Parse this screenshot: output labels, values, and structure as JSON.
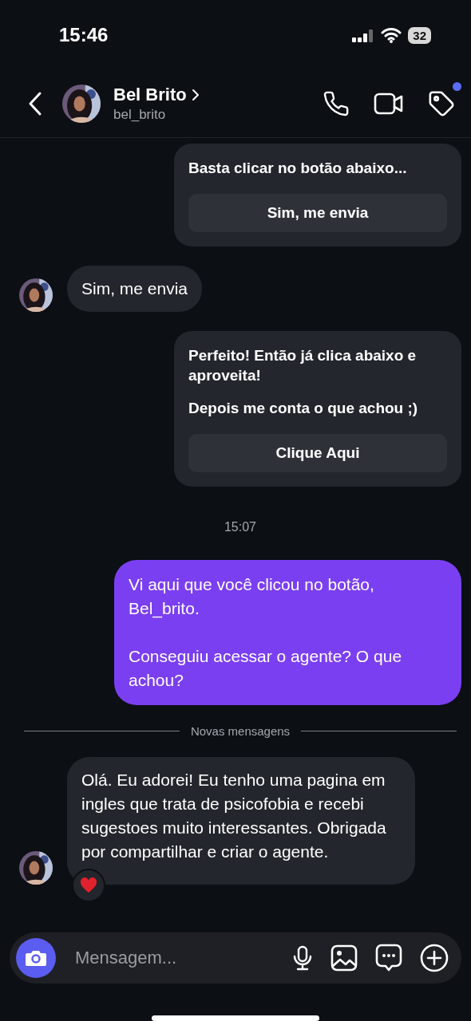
{
  "status_bar": {
    "time": "15:46",
    "battery": "32"
  },
  "header": {
    "name": "Bel Brito",
    "username": "bel_brito",
    "notification": true
  },
  "messages": [
    {
      "kind": "card",
      "paragraphs": [
        "Basta clicar no botão abaixo..."
      ],
      "button": "Sim, me envia"
    },
    {
      "kind": "incoming",
      "text": "Sim, me envia",
      "reacted": false
    },
    {
      "kind": "card",
      "paragraphs": [
        "Perfeito! Então já clica abaixo e aproveita!",
        "Depois me conta o que achou ;)"
      ],
      "button": "Clique Aqui"
    },
    {
      "kind": "timestamp",
      "text": "15:07"
    },
    {
      "kind": "outgoing",
      "paragraphs": [
        "Vi aqui que você clicou no botão, Bel_brito.",
        "Conseguiu acessar o agente? O que achou?"
      ]
    },
    {
      "kind": "divider",
      "text": "Novas mensagens"
    },
    {
      "kind": "incoming",
      "text": "Olá. Eu adorei! Eu tenho uma pagina em ingles que trata de psicofobia e recebi sugestoes muito interessantes. Obrigada por compartilhar e criar o agente.",
      "reacted": true
    }
  ],
  "composer": {
    "placeholder": "Mensagem..."
  }
}
